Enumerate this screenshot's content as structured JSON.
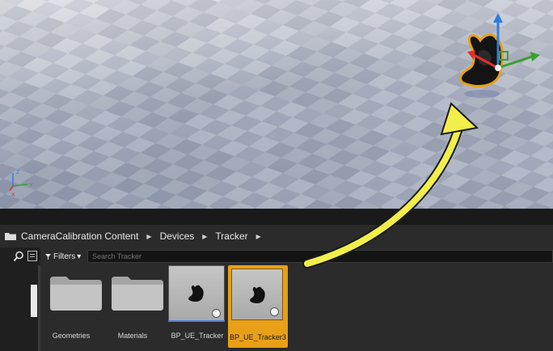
{
  "viewport": {
    "axis_labels": {
      "z": "Z",
      "x": "X",
      "y": "Y"
    },
    "gizmo_colors": {
      "x": "#e0302a",
      "y": "#3aa030",
      "z": "#2f7de0"
    },
    "highlight_arrow_color": "#f2ef4a"
  },
  "breadcrumb": {
    "items": [
      "CameraCalibration Content",
      "Devices",
      "Tracker"
    ],
    "arrow_glyph": "▶"
  },
  "toolbar": {
    "filters_label": "Filters",
    "filters_caret": "▾",
    "search_placeholder": "Search Tracker"
  },
  "assets": [
    {
      "name": "Geometries",
      "type": "folder"
    },
    {
      "name": "Materials",
      "type": "folder"
    },
    {
      "name": "BP_UE_Tracker",
      "type": "blueprint"
    },
    {
      "name": "BP_UE_Tracker3",
      "type": "blueprint",
      "selected": true
    }
  ],
  "colors": {
    "selection": "#e8a018",
    "panel_bg": "#2b2b2b",
    "dark_bg": "#1f1f1f"
  }
}
